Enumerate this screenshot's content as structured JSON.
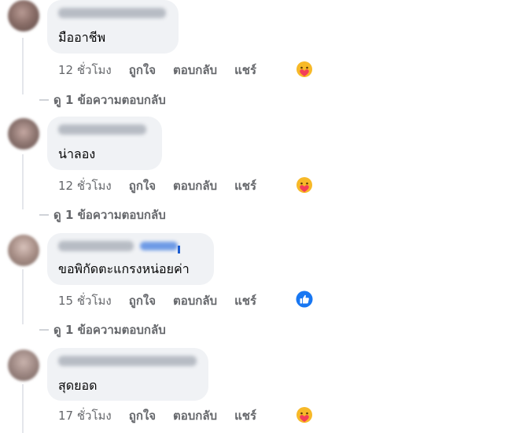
{
  "comments": [
    {
      "text": "มืออาชีพ",
      "time": "12 ชั่วโมง",
      "like": "ถูกใจ",
      "reply": "ตอบกลับ",
      "share": "แชร์",
      "reaction_icon": "care-emoji-icon",
      "view_replies": "ดู 1 ข้อความตอบกลับ"
    },
    {
      "text": "น่าลอง",
      "time": "12 ชั่วโมง",
      "like": "ถูกใจ",
      "reply": "ตอบกลับ",
      "share": "แชร์",
      "reaction_icon": "care-emoji-icon",
      "view_replies": "ดู 1 ข้อความตอบกลับ"
    },
    {
      "text": "ขอพิกัดตะแกรงหน่อยค่า",
      "time": "15 ชั่วโมง",
      "like": "ถูกใจ",
      "reply": "ตอบกลับ",
      "share": "แชร์",
      "reaction_icon": "thumbs-up-icon",
      "view_replies": "ดู 1 ข้อความตอบกลับ"
    },
    {
      "text": "สุดยอด",
      "time": "17 ชั่วโมง",
      "like": "ถูกใจ",
      "reply": "ตอบกลับ",
      "share": "แชร์",
      "reaction_icon": "care-emoji-icon"
    }
  ],
  "colors": {
    "bubble": "#f0f2f5",
    "meta_text": "#65676b",
    "like_blue": "#1877f2",
    "care_yellow": "#f7b928"
  }
}
